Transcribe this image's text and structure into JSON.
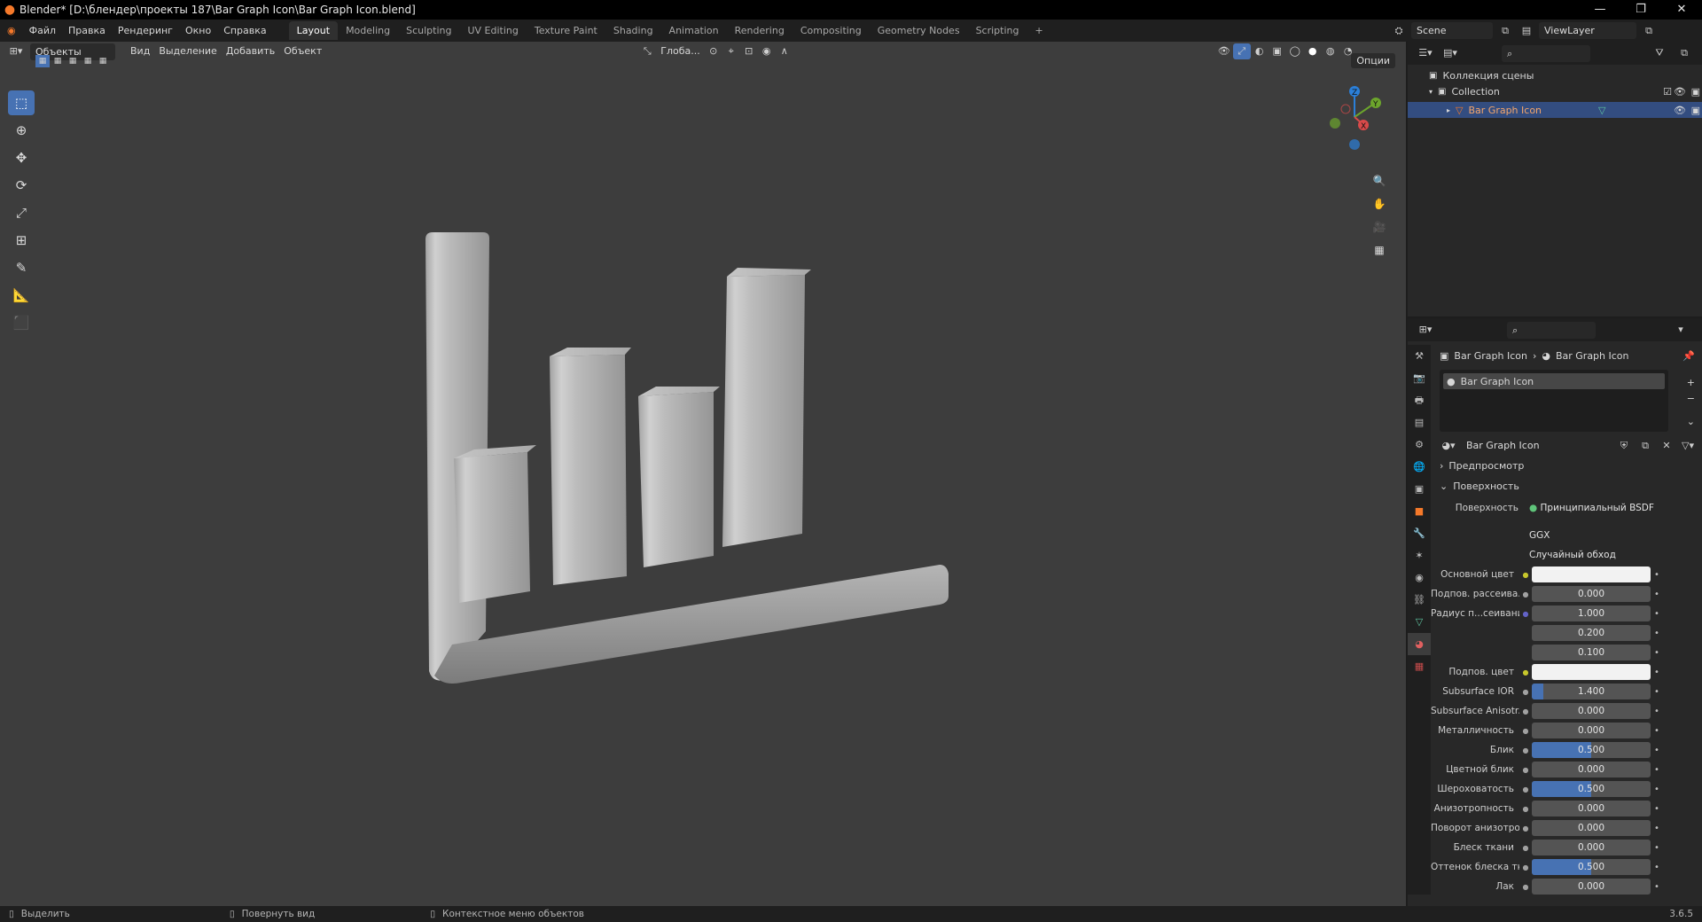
{
  "window": {
    "title": "Blender* [D:\\блендер\\проекты 187\\Bar Graph Icon\\Bar Graph Icon.blend]"
  },
  "menu": [
    "Файл",
    "Правка",
    "Рендеринг",
    "Окно",
    "Справка"
  ],
  "workspaces": [
    "Layout",
    "Modeling",
    "Sculpting",
    "UV Editing",
    "Texture Paint",
    "Shading",
    "Animation",
    "Rendering",
    "Compositing",
    "Geometry Nodes",
    "Scripting"
  ],
  "scene": {
    "name": "Scene",
    "view_layer": "ViewLayer"
  },
  "viewport_header": {
    "mode": "Объекты",
    "items": [
      "Вид",
      "Выделение",
      "Добавить",
      "Объект"
    ],
    "orientation": "Глоба...",
    "options": "Опции"
  },
  "outliner": {
    "root": "Коллекция сцены",
    "collection": "Collection",
    "object": "Bar Graph Icon"
  },
  "properties": {
    "breadcrumb": [
      "Bar Graph Icon",
      "Bar Graph Icon"
    ],
    "slot": "Bar Graph Icon",
    "material": "Bar Graph Icon",
    "panels": {
      "preview": "Предпросмотр",
      "surface": "Поверхность"
    },
    "surface_label": "Поверхность",
    "surface_shader": "Принципиальный BSDF",
    "distribution": "GGX",
    "subsurface_method": "Случайный обход",
    "rows": [
      {
        "label": "Основной цвет",
        "value": "",
        "socket": "yellow",
        "fill": 0,
        "color": true
      },
      {
        "label": "Подпов. рассеива...",
        "value": "0.000",
        "socket": "gray",
        "fill": 0
      },
      {
        "label": "Радиус п...сеивания",
        "value": "1.000",
        "socket": "purple",
        "fill": 0
      },
      {
        "label": "",
        "value": "0.200",
        "socket": "",
        "fill": 0
      },
      {
        "label": "",
        "value": "0.100",
        "socket": "",
        "fill": 0
      },
      {
        "label": "Подпов. цвет",
        "value": "",
        "socket": "yellow",
        "fill": 0,
        "color": true
      },
      {
        "label": "Subsurface IOR",
        "value": "1.400",
        "socket": "gray",
        "fill": 0.1
      },
      {
        "label": "Subsurface Anisotr...",
        "value": "0.000",
        "socket": "gray",
        "fill": 0
      },
      {
        "label": "Металличность",
        "value": "0.000",
        "socket": "gray",
        "fill": 0
      },
      {
        "label": "Блик",
        "value": "0.500",
        "socket": "gray",
        "fill": 0.5
      },
      {
        "label": "Цветной блик",
        "value": "0.000",
        "socket": "gray",
        "fill": 0
      },
      {
        "label": "Шероховатость",
        "value": "0.500",
        "socket": "gray",
        "fill": 0.5
      },
      {
        "label": "Анизотропность",
        "value": "0.000",
        "socket": "gray",
        "fill": 0
      },
      {
        "label": "Поворот анизотро...",
        "value": "0.000",
        "socket": "gray",
        "fill": 0
      },
      {
        "label": "Блеск ткани",
        "value": "0.000",
        "socket": "gray",
        "fill": 0
      },
      {
        "label": "Оттенок блеска тк...",
        "value": "0.500",
        "socket": "gray",
        "fill": 0.5
      },
      {
        "label": "Лак",
        "value": "0.000",
        "socket": "gray",
        "fill": 0
      }
    ]
  },
  "statusbar": {
    "select": "Выделить",
    "rotate": "Повернуть вид",
    "context": "Контекстное меню объектов",
    "version": "3.6.5"
  },
  "colors": {
    "accent": "#4772b3",
    "selection": "#f5792a"
  }
}
